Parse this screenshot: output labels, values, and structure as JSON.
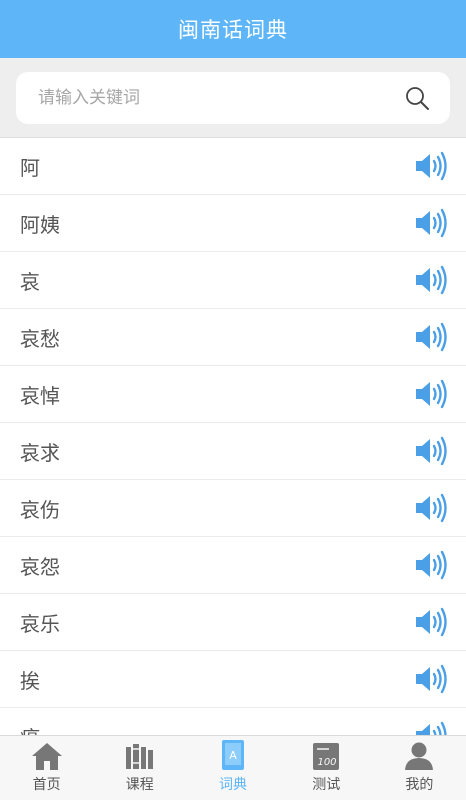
{
  "header": {
    "title": "闽南话词典"
  },
  "search": {
    "placeholder": "请输入关键词",
    "value": ""
  },
  "entries": [
    "阿",
    "阿姨",
    "哀",
    "哀愁",
    "哀悼",
    "哀求",
    "哀伤",
    "哀怨",
    "哀乐",
    "挨",
    "癌"
  ],
  "tabs": [
    {
      "label": "首页",
      "icon": "home-icon",
      "active": false
    },
    {
      "label": "课程",
      "icon": "books-icon",
      "active": false
    },
    {
      "label": "词典",
      "icon": "dictionary-icon",
      "active": true
    },
    {
      "label": "测试",
      "icon": "test-icon",
      "active": false
    },
    {
      "label": "我的",
      "icon": "profile-icon",
      "active": false
    }
  ],
  "colors": {
    "accent": "#5eb6f8",
    "tab_icon": "#777777",
    "speaker": "#4a9fe6"
  }
}
